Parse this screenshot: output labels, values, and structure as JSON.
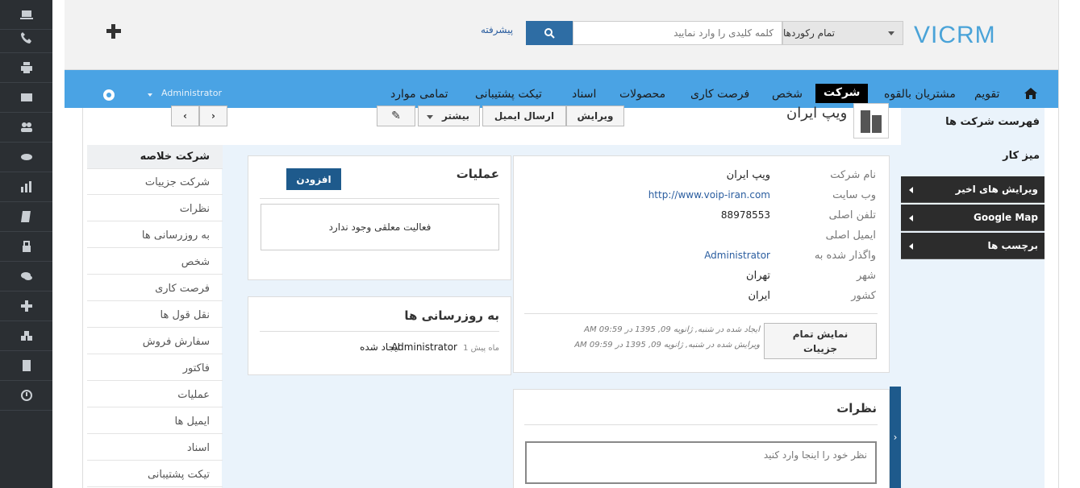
{
  "header": {
    "logo": "VICRM",
    "record_filter": "تمام رکوردها",
    "search_placeholder": "کلمه کلیدی را وارد نمایید",
    "advanced_label": "پیشرفته"
  },
  "nav": {
    "items": [
      {
        "label": "تقویم"
      },
      {
        "label": "مشتریان بالقوه"
      },
      {
        "label": "شرکت"
      },
      {
        "label": "شخص"
      },
      {
        "label": "فرصت کاری"
      },
      {
        "label": "محصولات"
      },
      {
        "label": "اسناد"
      },
      {
        "label": "تیکت پشتیبانی"
      },
      {
        "label": "تمامی موارد"
      }
    ],
    "user": "Administrator"
  },
  "record": {
    "title": "ویپ ایران",
    "buttons": {
      "edit": "ویرایش",
      "send_email": "ارسال ایمیل",
      "more": "بیشتر"
    }
  },
  "side_menu": [
    "شرکت خلاصه",
    "شرکت جزییات",
    "نظرات",
    "به روزرسانی ها",
    "شخص",
    "فرصت کاری",
    "نقل قول ها",
    "سفارش فروش",
    "فاکتور",
    "عملیات",
    "ایمیل ها",
    "اسناد",
    "تیکت پشتیبانی"
  ],
  "summary": {
    "fields": [
      {
        "label": "نام شرکت",
        "value": "ویپ ایران"
      },
      {
        "label": "وب سایت",
        "value": "http://www.voip-iran.com"
      },
      {
        "label": "تلفن اصلی",
        "value": "88978553"
      },
      {
        "label": "ایمیل اصلی",
        "value": ""
      },
      {
        "label": "واگذار شده به",
        "value": "Administrator"
      },
      {
        "label": "شهر",
        "value": "تهران"
      },
      {
        "label": "کشور",
        "value": "ایران"
      }
    ],
    "show_all_button": "نمایش تمام جزییات",
    "created_text": "ایجاد شده در شنبه, ژانویه 09, 1395 در 09:59 AM",
    "modified_text": "ویرایش شده در شنبه, ژانویه 09, 1395 در 09:59 AM"
  },
  "activities": {
    "title": "عملیات",
    "add_button": "افزودن",
    "empty_text": "فعالیت معلقی وجود ندارد"
  },
  "updates": {
    "title": "به روزرسانی ها",
    "time": "1 ماه پیش",
    "user": "Administrator",
    "action": "ایجاد شده"
  },
  "comments": {
    "title": "نظرات",
    "placeholder": "نظر خود را اینجا وارد کنید"
  },
  "right_panel": {
    "list_link": "فهرست شرکت ها",
    "desk_link": "میز کار",
    "sections": [
      "ویرایش های اخیر",
      "Google Map",
      "برچسب ها"
    ]
  }
}
